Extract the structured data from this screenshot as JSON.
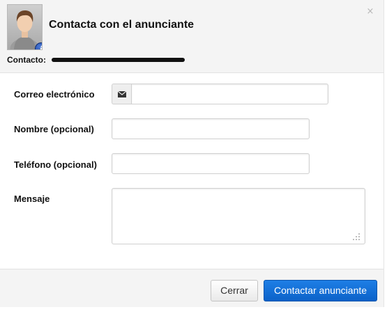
{
  "dialog": {
    "title": "Contacta con el anunciante",
    "close_label": "×",
    "avatar_badge": "i",
    "contact_label": "Contacto:",
    "contact_value": "",
    "contact_value_redacted": true
  },
  "form": {
    "email": {
      "label": "Correo electrónico",
      "value": "",
      "placeholder": "",
      "icon": "envelope-icon"
    },
    "name": {
      "label": "Nombre (opcional)",
      "value": "",
      "placeholder": ""
    },
    "phone": {
      "label": "Teléfono (opcional)",
      "value": "",
      "placeholder": ""
    },
    "message": {
      "label": "Mensaje",
      "value": "",
      "placeholder": ""
    }
  },
  "footer": {
    "cancel_label": "Cerrar",
    "submit_label": "Contactar anunciante"
  },
  "colors": {
    "primary_button": "#0b6fd8",
    "header_background": "#f4f4f4",
    "badge": "#1a43a8"
  }
}
